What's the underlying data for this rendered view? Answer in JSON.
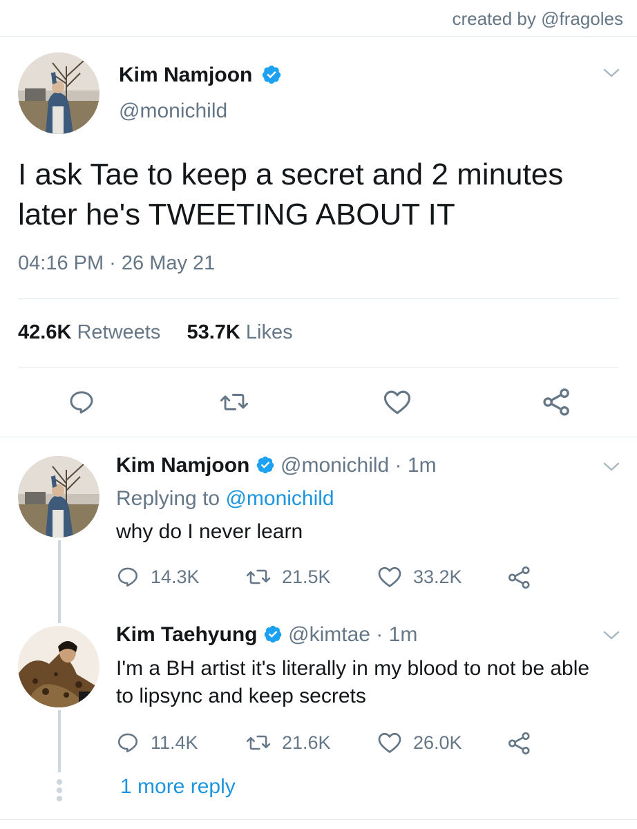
{
  "header": {
    "credit": "created by @fragoles"
  },
  "main_tweet": {
    "name": "Kim Namjoon",
    "handle": "@monichild",
    "text": "I ask Tae to keep a secret and 2 minutes later he's TWEETING ABOUT IT",
    "time": "04:16 PM · 26 May 21",
    "retweets_count": "42.6K",
    "retweets_label": "Retweets",
    "likes_count": "53.7K",
    "likes_label": "Likes",
    "icons": [
      "reply-icon",
      "retweet-icon",
      "like-icon",
      "share-icon"
    ]
  },
  "reply1": {
    "name": "Kim Namjoon",
    "handle_time": "@monichild · 1m",
    "replying_prefix": "Replying to",
    "replying_handle": "@monichild",
    "text": "why do I never learn",
    "reply_count": "14.3K",
    "retweet_count": "21.5K",
    "like_count": "33.2K"
  },
  "reply2": {
    "name": "Kim Taehyung",
    "handle_time": "@kimtae · 1m",
    "text": "I'm a BH artist it's literally in my blood to not be able to lipsync and keep secrets",
    "reply_count": "11.4K",
    "retweet_count": "21.6K",
    "like_count": "26.0K"
  },
  "more_replies": "1 more reply",
  "colors": {
    "accent": "#1b95e0",
    "muted": "#657786",
    "divider": "#e1e8ed",
    "verified": "#1da1f2"
  }
}
